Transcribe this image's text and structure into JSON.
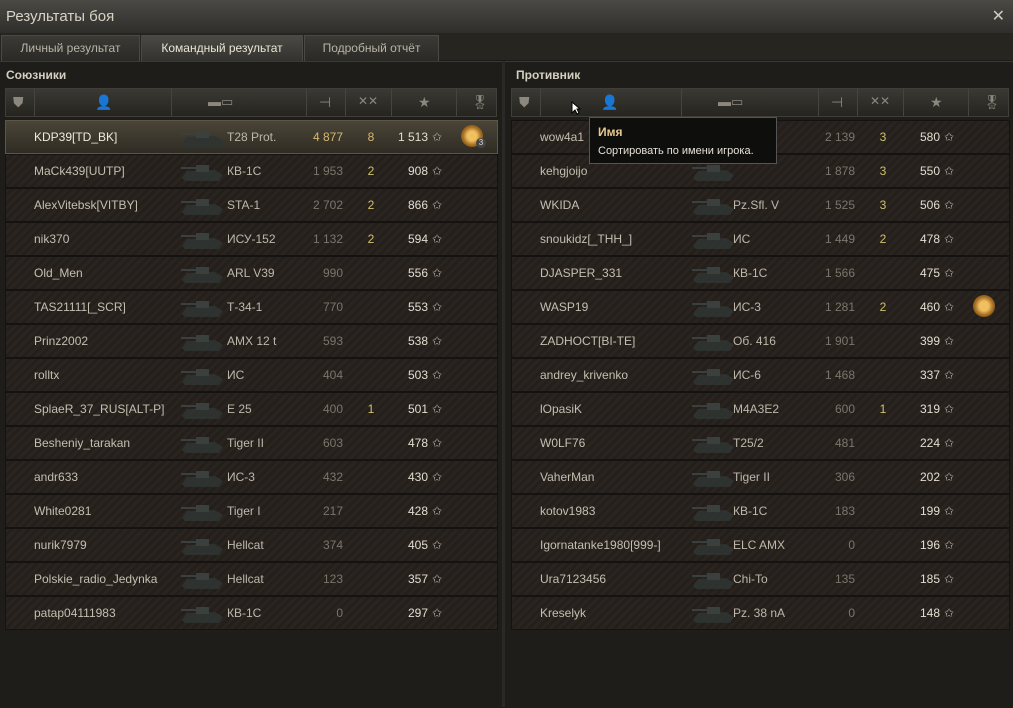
{
  "window": {
    "title": "Результаты боя",
    "close_icon": "close-icon"
  },
  "tabs": [
    {
      "label": "Личный результат",
      "active": false
    },
    {
      "label": "Командный результат",
      "active": true
    },
    {
      "label": "Подробный отчёт",
      "active": false
    }
  ],
  "columns": {
    "icons": [
      "platoon-icon",
      "player-icon",
      "tank-icon",
      "damage-icon",
      "kills-icon",
      "xp-star-icon",
      "medal-icon"
    ],
    "sorted_column": "xp"
  },
  "allies": {
    "title": "Союзники",
    "rows": [
      {
        "name": "KDP39[TD_BK]",
        "vehicle": "T28 Prot.",
        "damage": "4 877",
        "kills": "8",
        "xp": "1 513",
        "medal": true,
        "medal_count": "3",
        "self": true
      },
      {
        "name": "MaCk439[UUTP]",
        "vehicle": "КВ-1С",
        "damage": "1 953",
        "kills": "2",
        "xp": "908"
      },
      {
        "name": "AlexVitebsk[VITBY]",
        "vehicle": "STA-1",
        "damage": "2 702",
        "kills": "2",
        "xp": "866"
      },
      {
        "name": "nik370",
        "vehicle": "ИСУ-152",
        "damage": "1 132",
        "kills": "2",
        "xp": "594"
      },
      {
        "name": "Old_Men",
        "vehicle": "ARL V39",
        "damage": "990",
        "kills": "",
        "xp": "556"
      },
      {
        "name": "TAS21111[_SCR]",
        "vehicle": "Т-34-1",
        "damage": "770",
        "kills": "",
        "xp": "553"
      },
      {
        "name": "Prinz2002",
        "vehicle": "AMX 12 t",
        "damage": "593",
        "kills": "",
        "xp": "538"
      },
      {
        "name": "rolltx",
        "vehicle": "ИС",
        "damage": "404",
        "kills": "",
        "xp": "503"
      },
      {
        "name": "SplaeR_37_RUS[ALT-P]",
        "vehicle": "E 25",
        "damage": "400",
        "kills": "1",
        "xp": "501"
      },
      {
        "name": "Besheniy_tarakan",
        "vehicle": "Tiger II",
        "damage": "603",
        "kills": "",
        "xp": "478"
      },
      {
        "name": "andr633",
        "vehicle": "ИС-3",
        "damage": "432",
        "kills": "",
        "xp": "430"
      },
      {
        "name": "White0281",
        "vehicle": "Tiger I",
        "damage": "217",
        "kills": "",
        "xp": "428"
      },
      {
        "name": "nurik7979",
        "vehicle": "Hellcat",
        "damage": "374",
        "kills": "",
        "xp": "405"
      },
      {
        "name": "Polskie_radio_Jedynka",
        "vehicle": "Hellcat",
        "damage": "123",
        "kills": "",
        "xp": "357"
      },
      {
        "name": "patap04111983",
        "vehicle": "КВ-1С",
        "damage": "0",
        "kills": "",
        "xp": "297"
      }
    ]
  },
  "enemies": {
    "title": "Противник",
    "rows": [
      {
        "name": "wow4a1",
        "vehicle": "",
        "damage": "2 139",
        "kills": "3",
        "xp": "580"
      },
      {
        "name": "kehgjoijo",
        "vehicle": "",
        "damage": "1 878",
        "kills": "3",
        "xp": "550"
      },
      {
        "name": "WKIDA",
        "vehicle": "Pz.Sfl. V",
        "damage": "1 525",
        "kills": "3",
        "xp": "506"
      },
      {
        "name": "snoukidz[_THH_]",
        "vehicle": "ИС",
        "damage": "1 449",
        "kills": "2",
        "xp": "478"
      },
      {
        "name": "DJASPER_331",
        "vehicle": "КВ-1С",
        "damage": "1 566",
        "kills": "",
        "xp": "475"
      },
      {
        "name": "WASP19",
        "vehicle": "ИС-3",
        "damage": "1 281",
        "kills": "2",
        "xp": "460",
        "medal": true
      },
      {
        "name": "ZADHOCT[BI-TE]",
        "vehicle": "Об. 416",
        "damage": "1 901",
        "kills": "",
        "xp": "399"
      },
      {
        "name": "andrey_krivenko",
        "vehicle": "ИС-6",
        "damage": "1 468",
        "kills": "",
        "xp": "337"
      },
      {
        "name": "lOpasiK",
        "vehicle": "M4A3E2",
        "damage": "600",
        "kills": "1",
        "xp": "319"
      },
      {
        "name": "W0LF76",
        "vehicle": "T25/2",
        "damage": "481",
        "kills": "",
        "xp": "224"
      },
      {
        "name": "VaherMan",
        "vehicle": "Tiger II",
        "damage": "306",
        "kills": "",
        "xp": "202"
      },
      {
        "name": "kotov1983",
        "vehicle": "КВ-1С",
        "damage": "183",
        "kills": "",
        "xp": "199"
      },
      {
        "name": "Igornatanke1980[999-]",
        "vehicle": "ELC AMX",
        "damage": "0",
        "kills": "",
        "xp": "196"
      },
      {
        "name": "Ura7123456",
        "vehicle": "Chi-To",
        "damage": "135",
        "kills": "",
        "xp": "185"
      },
      {
        "name": "Kreselyk",
        "vehicle": "Pz. 38 nA",
        "damage": "0",
        "kills": "",
        "xp": "148"
      }
    ]
  },
  "tooltip": {
    "title": "Имя",
    "text": "Сортировать по имени игрока."
  }
}
